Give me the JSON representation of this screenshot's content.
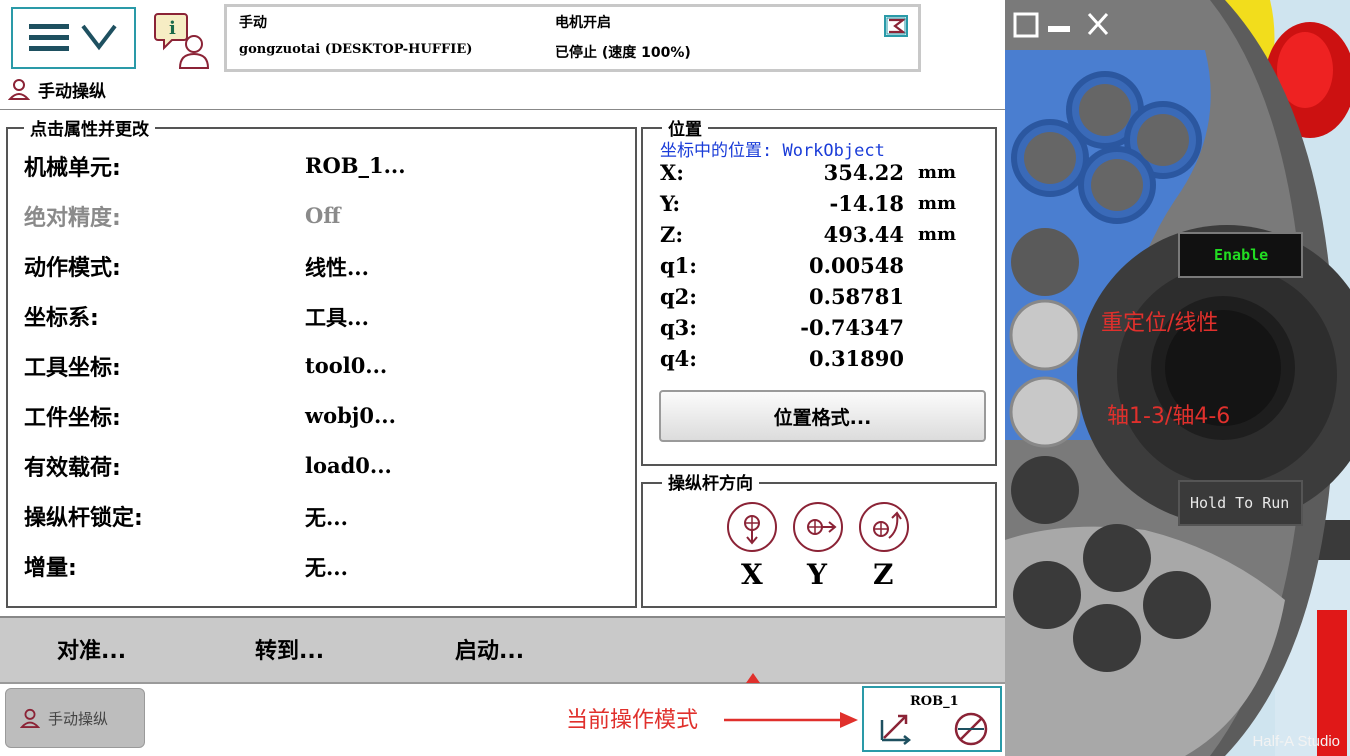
{
  "header": {
    "mode_title": "手动",
    "controller": "gongzuotai (DESKTOP-HUFFIE)",
    "motor_state": "电机开启",
    "run_state": "已停止 (速度 100%)"
  },
  "window": {
    "title": "手动操纵"
  },
  "properties": {
    "legend": "点击属性并更改",
    "rows": [
      {
        "label": "机械单元:",
        "value": "ROB_1...",
        "enabled": true
      },
      {
        "label": "绝对精度:",
        "value": "Off",
        "enabled": false
      },
      {
        "label": "动作模式:",
        "value": "线性...",
        "enabled": true
      },
      {
        "label": "坐标系:",
        "value": "工具...",
        "enabled": true
      },
      {
        "label": "工具坐标:",
        "value": "tool0...",
        "enabled": true
      },
      {
        "label": "工件坐标:",
        "value": "wobj0...",
        "enabled": true
      },
      {
        "label": "有效载荷:",
        "value": "load0...",
        "enabled": true
      },
      {
        "label": "操纵杆锁定:",
        "value": "无...",
        "enabled": true
      },
      {
        "label": "增量:",
        "value": "无...",
        "enabled": true
      }
    ]
  },
  "position": {
    "legend": "位置",
    "coord_label": "坐标中的位置: WorkObject",
    "rows": [
      {
        "key": "X:",
        "value": "354.22",
        "unit": "mm"
      },
      {
        "key": "Y:",
        "value": "-14.18",
        "unit": "mm"
      },
      {
        "key": "Z:",
        "value": "493.44",
        "unit": "mm"
      },
      {
        "key": "q1:",
        "value": "0.00548",
        "unit": ""
      },
      {
        "key": "q2:",
        "value": "0.58781",
        "unit": ""
      },
      {
        "key": "q3:",
        "value": "-0.74347",
        "unit": ""
      },
      {
        "key": "q4:",
        "value": "0.31890",
        "unit": ""
      }
    ],
    "format_button": "位置格式..."
  },
  "joystick": {
    "legend": "操纵杆方向",
    "axes": [
      "X",
      "Y",
      "Z"
    ]
  },
  "commands": {
    "align": "对准...",
    "goto": "转到...",
    "start": "启动..."
  },
  "taskbar": {
    "task_label": "手动操纵",
    "quickset_unit": "ROB_1"
  },
  "annotations": {
    "current_mode": "当前操作模式",
    "reorient_linear": "重定位/线性",
    "axis_toggle": "轴1-3/轴4-6"
  },
  "device": {
    "enable_label": "Enable",
    "hold_to_run_label": "Hold To Run",
    "watermark": "Half-A Studio"
  },
  "colors": {
    "accent_teal": "#2a9aa8",
    "annotation_red": "#e0302c",
    "icon_maroon": "#8b2336",
    "coord_blue": "#1a3cd8",
    "enable_green": "#22dd22",
    "device_blue": "#4a7ed0",
    "device_yellow": "#f2dd1c",
    "device_red": "#e01818"
  }
}
